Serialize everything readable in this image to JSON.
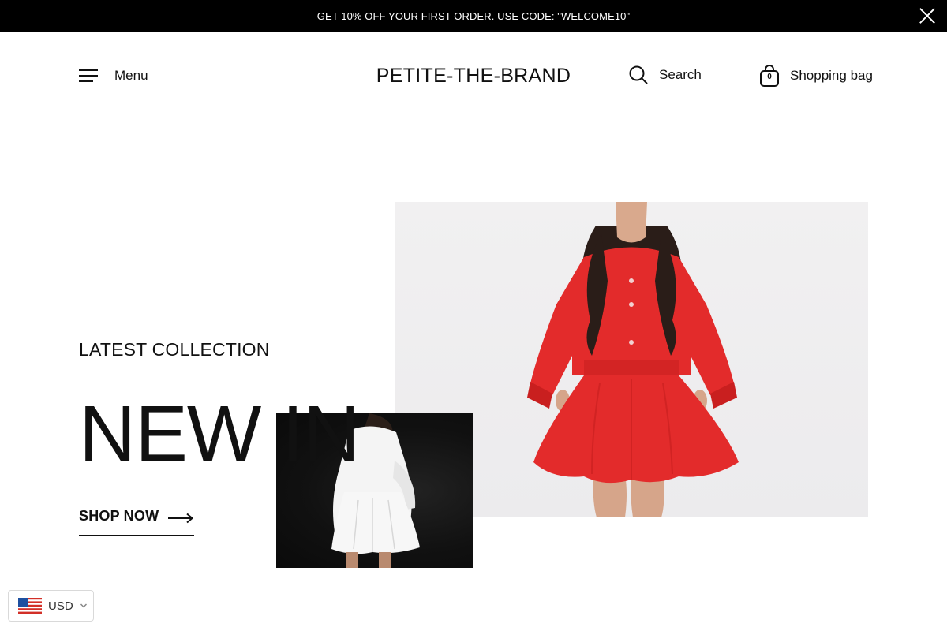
{
  "announcement": {
    "text": "GET 10% OFF YOUR FIRST ORDER. USE CODE: \"WELCOME10\""
  },
  "header": {
    "menu_label": "Menu",
    "brand": "PETITE-THE-BRAND",
    "search_label": "Search",
    "bag_label": "Shopping bag",
    "bag_count": "0"
  },
  "hero": {
    "subtitle": "LATEST COLLECTION",
    "title": "NEW IN",
    "cta_label": "SHOP NOW"
  },
  "currency": {
    "code": "USD"
  },
  "colors": {
    "announcement_bg": "#000000",
    "text": "#111111",
    "main_image_bg": "#eeedef",
    "outfit_red": "#e32b2b",
    "secondary_image_bg": "#111111"
  },
  "icons": [
    "close-icon",
    "hamburger-icon",
    "search-icon",
    "shopping-bag-icon",
    "arrow-right-icon",
    "us-flag-icon",
    "chevron-down-icon"
  ]
}
